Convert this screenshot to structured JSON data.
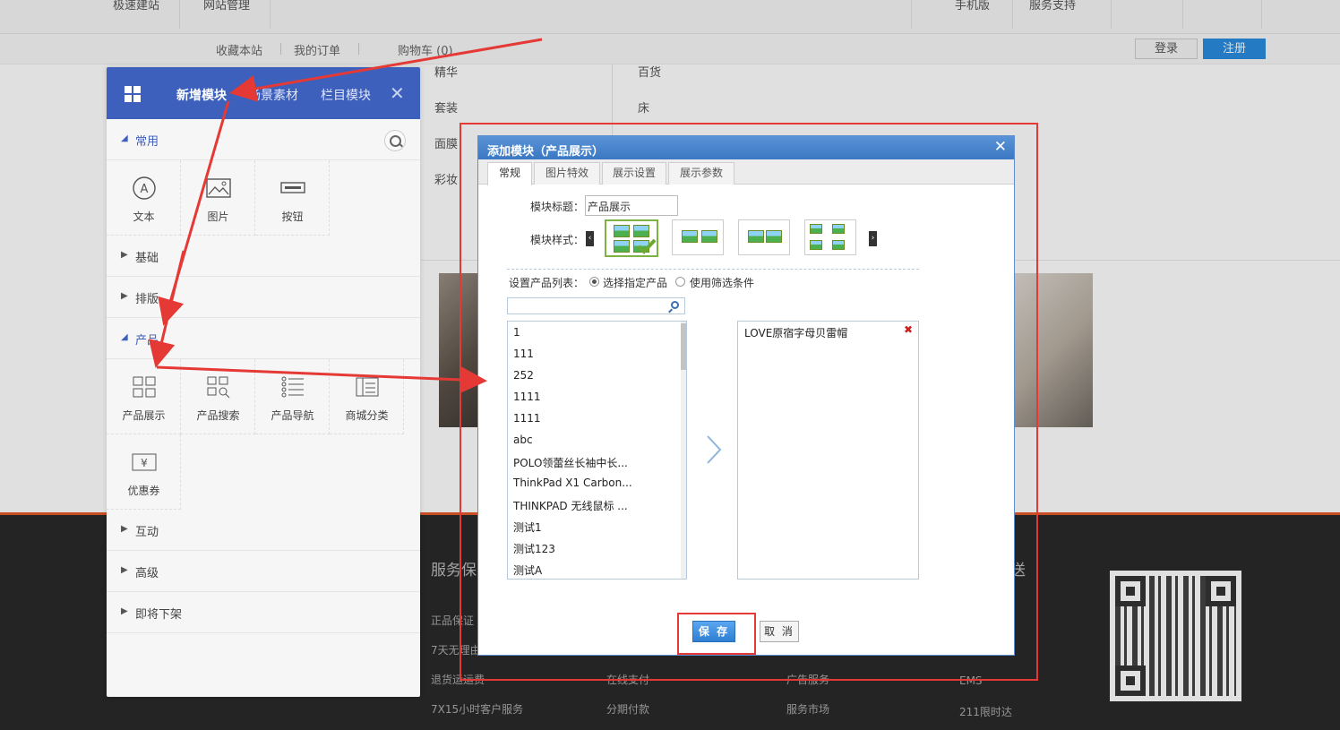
{
  "topbar": {
    "left": [
      "极速建站",
      "网站管理"
    ],
    "right": [
      "手机版",
      "服务支持"
    ]
  },
  "subbar": {
    "favorite": "收藏本站",
    "orders": "我的订单",
    "cart": "购物车 (0)",
    "login": "登录",
    "register": "注册"
  },
  "background": {
    "categories_left": [
      "精华",
      "套装",
      "面膜",
      "彩妆"
    ],
    "categories_right": [
      "百货",
      "床"
    ],
    "footer_heads": [
      "服务保",
      "送"
    ],
    "footer_col1": [
      "正品保证",
      "7天无理由",
      "退货运运费",
      "7X15小时客户服务"
    ],
    "footer_col2": [
      "在线支付",
      "分期付款"
    ],
    "footer_col3": [
      "广告服务",
      "服务市场"
    ],
    "footer_col4": [
      "EMS",
      "211限时达"
    ]
  },
  "panel": {
    "tabs": [
      "新增模块",
      "场景素材",
      "栏目模块"
    ],
    "sections": {
      "common": "常用",
      "basic": "基础",
      "layout": "排版",
      "product": "产品",
      "interactive": "互动",
      "advanced": "高级",
      "coming": "即将下架"
    },
    "common_tiles": [
      "文本",
      "图片",
      "按钮"
    ],
    "product_tiles": [
      "产品展示",
      "产品搜索",
      "产品导航",
      "商城分类",
      "优惠券"
    ]
  },
  "dialog": {
    "title": "添加模块（产品展示）",
    "tabs": [
      "常规",
      "图片特效",
      "展示设置",
      "展示参数"
    ],
    "module_title_label": "模块标题：",
    "module_title_value": "产品展示",
    "module_style_label": "模块样式：",
    "product_list_label": "设置产品列表：",
    "radio_specified": "选择指定产品",
    "radio_filter": "使用筛选条件",
    "available_products": [
      "1",
      "111",
      "252",
      "1111",
      "1111",
      "abc",
      "POLO领蕾丝长袖中长...",
      "ThinkPad X1 Carbon...",
      "THINKPAD 无线鼠标 ...",
      "测试1",
      "测试123",
      "测试A"
    ],
    "selected_products": [
      "LOVE原宿字母贝雷帽"
    ],
    "save": "保 存",
    "cancel": "取 消"
  },
  "colors": {
    "panel_header": "#3e60bd",
    "dialog_title": "#3b78c3",
    "annotation": "#e53935",
    "footer_bg": "#2a2a2a"
  }
}
